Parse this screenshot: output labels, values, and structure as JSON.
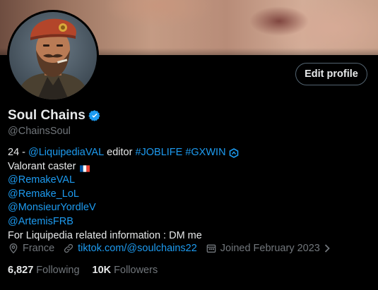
{
  "profile": {
    "name": "Soul Chains",
    "handle": "@ChainsSoul",
    "edit_label": "Edit profile"
  },
  "bio": {
    "line1_prefix": "24 - ",
    "line1_mention": "@LiquipediaVAL",
    "line1_mid": " editor ",
    "line1_tag1": "#JOBLIFE",
    "line1_tag2": "#GXWIN",
    "line2": "Valorant caster",
    "mention1": "@RemakeVAL",
    "mention2": "@Remake_LoL",
    "mention3": "@MonsieurYordleV",
    "mention4": "@ArtemisFRB",
    "line7": "For Liquipedia related information : DM me"
  },
  "meta": {
    "location": "France",
    "website": "tiktok.com/@soulchains22",
    "joined": "Joined February 2023"
  },
  "stats": {
    "following_count": "6,827",
    "following_label": "Following",
    "followers_count": "10K",
    "followers_label": "Followers"
  },
  "colors": {
    "accent": "#1d9bf0",
    "muted": "#71767b",
    "text": "#e7e9ea",
    "background": "#000000"
  },
  "icons": {
    "verified": "verified-badge-icon",
    "location": "location-pin-icon",
    "website": "link-icon",
    "joined": "calendar-icon",
    "more": "chevron-right-icon",
    "flag": "france-flag-icon",
    "brand": "gx-brand-icon"
  }
}
